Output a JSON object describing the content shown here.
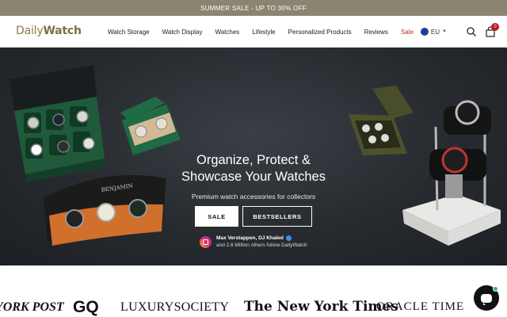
{
  "announcement": {
    "text": "SUMMER SALE - UP TO 30% OFF"
  },
  "header": {
    "logo": {
      "part1": "Daily",
      "part2": "Watch"
    },
    "nav": [
      {
        "label": "Watch Storage"
      },
      {
        "label": "Watch Display"
      },
      {
        "label": "Watches"
      },
      {
        "label": "Lifestyle"
      },
      {
        "label": "Personalized Products"
      },
      {
        "label": "Reviews"
      },
      {
        "label": "Sale"
      }
    ],
    "locale": "EU",
    "cart_count": "0",
    "icons": [
      "eu-flag-icon",
      "chevron-down-icon",
      "search-icon",
      "cart-icon"
    ]
  },
  "hero": {
    "title_line1": "Organize, Protect &",
    "title_line2": "Showcase Your Watches",
    "subtitle": "Premium watch accessories for collectors",
    "sale_button": "SALE",
    "bestsellers_button": "BESTSELLERS",
    "social": {
      "names": "Max Verstappen, DJ Khaled",
      "followers": "and 2,6 Million others follow DailyWatch"
    },
    "case_engraving": "BENJAMIN"
  },
  "press": [
    {
      "name": "YORK POST"
    },
    {
      "name": "GQ"
    },
    {
      "name": "LUXURYSOCIETY"
    },
    {
      "name": "The New York Times"
    },
    {
      "name": "ORACLE TIME"
    }
  ],
  "colors": {
    "announcement_bg": "#8a8470",
    "brand": "#8a7a4e",
    "sale_red": "#c32222",
    "hero_bg": "#272b30",
    "case_green": "#1f5a3a"
  }
}
